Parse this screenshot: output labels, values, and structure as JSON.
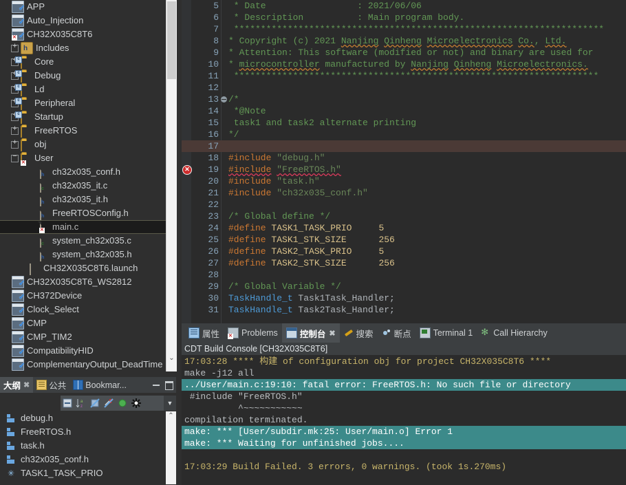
{
  "project_explorer": {
    "items": [
      {
        "label": "APP",
        "icon": "project-icon",
        "indent": 0,
        "twisty": "none",
        "kind": "project"
      },
      {
        "label": "Auto_Injection",
        "icon": "project-icon",
        "indent": 0,
        "twisty": "none",
        "kind": "project"
      },
      {
        "label": "CH32X035C8T6",
        "icon": "project-icon-error",
        "indent": 0,
        "twisty": "none",
        "kind": "project"
      },
      {
        "label": "Includes",
        "icon": "includes-icon",
        "indent": 1,
        "twisty": "plus",
        "kind": "includes"
      },
      {
        "label": "Core",
        "icon": "source-folder-icon",
        "indent": 1,
        "twisty": "plus",
        "kind": "srcfolder"
      },
      {
        "label": "Debug",
        "icon": "source-folder-icon",
        "indent": 1,
        "twisty": "plus",
        "kind": "srcfolder"
      },
      {
        "label": "Ld",
        "icon": "source-folder-icon",
        "indent": 1,
        "twisty": "plus",
        "kind": "srcfolder"
      },
      {
        "label": "Peripheral",
        "icon": "source-folder-icon",
        "indent": 1,
        "twisty": "plus",
        "kind": "srcfolder"
      },
      {
        "label": "Startup",
        "icon": "source-folder-icon",
        "indent": 1,
        "twisty": "plus",
        "kind": "srcfolder"
      },
      {
        "label": "FreeRTOS",
        "icon": "folder-icon",
        "indent": 1,
        "twisty": "plus",
        "kind": "folder"
      },
      {
        "label": "obj",
        "icon": "folder-icon",
        "indent": 1,
        "twisty": "plus",
        "kind": "folder"
      },
      {
        "label": "User",
        "icon": "folder-icon-error",
        "indent": 1,
        "twisty": "minus",
        "kind": "folder-err"
      },
      {
        "label": "ch32x035_conf.h",
        "icon": "header-file-icon",
        "indent": 3,
        "twisty": "none",
        "kind": "h"
      },
      {
        "label": "ch32x035_it.c",
        "icon": "c-file-icon",
        "indent": 3,
        "twisty": "none",
        "kind": "c"
      },
      {
        "label": "ch32x035_it.h",
        "icon": "header-file-icon",
        "indent": 3,
        "twisty": "none",
        "kind": "h"
      },
      {
        "label": "FreeRTOSConfig.h",
        "icon": "header-file-icon",
        "indent": 3,
        "twisty": "none",
        "kind": "h"
      },
      {
        "label": "main.c",
        "icon": "c-file-icon-error",
        "indent": 3,
        "twisty": "none",
        "kind": "c-err",
        "selected": true
      },
      {
        "label": "system_ch32x035.c",
        "icon": "c-file-icon",
        "indent": 3,
        "twisty": "none",
        "kind": "c"
      },
      {
        "label": "system_ch32x035.h",
        "icon": "header-file-icon",
        "indent": 3,
        "twisty": "none",
        "kind": "h"
      },
      {
        "label": "CH32X035C8T6.launch",
        "icon": "launch-file-icon",
        "indent": 2,
        "twisty": "none",
        "kind": "launch"
      },
      {
        "label": "CH32X035C8T6_WS2812",
        "icon": "project-icon",
        "indent": 0,
        "twisty": "none",
        "kind": "project"
      },
      {
        "label": "CH372Device",
        "icon": "project-icon",
        "indent": 0,
        "twisty": "none",
        "kind": "project"
      },
      {
        "label": "Clock_Select",
        "icon": "project-icon",
        "indent": 0,
        "twisty": "none",
        "kind": "project"
      },
      {
        "label": "CMP",
        "icon": "project-icon",
        "indent": 0,
        "twisty": "none",
        "kind": "project"
      },
      {
        "label": "CMP_TIM2",
        "icon": "project-icon",
        "indent": 0,
        "twisty": "none",
        "kind": "project"
      },
      {
        "label": "CompatibilityHID",
        "icon": "project-icon",
        "indent": 0,
        "twisty": "none",
        "kind": "project"
      },
      {
        "label": "ComplementaryOutput_DeadTime",
        "icon": "project-icon",
        "indent": 0,
        "twisty": "none",
        "kind": "project"
      }
    ]
  },
  "outline_panel": {
    "tabs": [
      {
        "label": "大纲",
        "active": true,
        "closable": true,
        "icon": "outline-icon"
      },
      {
        "label": "公共",
        "active": false,
        "closable": false,
        "icon": "public-icon"
      },
      {
        "label": "Bookmar...",
        "active": false,
        "closable": false,
        "icon": "bookmark-icon"
      }
    ],
    "window_buttons": [
      "minimize",
      "maximize"
    ],
    "toolbar_icons": [
      "collapse-all-icon",
      "sort-icon",
      "hide-fields-icon",
      "hide-static-icon",
      "hide-nonpublic-icon",
      "hide-macros-icon",
      "view-menu-icon"
    ],
    "items": [
      {
        "label": "debug.h",
        "icon": "include-icon"
      },
      {
        "label": "FreeRTOS.h",
        "icon": "include-icon"
      },
      {
        "label": "task.h",
        "icon": "include-icon"
      },
      {
        "label": "ch32x035_conf.h",
        "icon": "include-icon"
      },
      {
        "label": "TASK1_TASK_PRIO",
        "icon": "macro-icon"
      }
    ]
  },
  "editor": {
    "lines": [
      {
        "n": "5",
        "marker": "",
        "fold": false,
        "segs": [
          {
            "t": " * Date                 : 2021/06/06",
            "c": "cmt"
          }
        ]
      },
      {
        "n": "6",
        "marker": "",
        "fold": false,
        "segs": [
          {
            "t": " * Description          : Main program body.",
            "c": "cmt"
          }
        ]
      },
      {
        "n": "7",
        "marker": "",
        "fold": false,
        "segs": [
          {
            "t": " *********************************************************************",
            "c": "cmt"
          }
        ]
      },
      {
        "n": "8",
        "marker": "",
        "fold": false,
        "segs": [
          {
            "t": "* Copyright (c) 2021 ",
            "c": "cmt"
          },
          {
            "t": "Nanjing",
            "c": "cmt wavy-o"
          },
          {
            "t": " ",
            "c": "cmt"
          },
          {
            "t": "Qinheng",
            "c": "cmt wavy-o"
          },
          {
            "t": " ",
            "c": "cmt"
          },
          {
            "t": "Microelectronics",
            "c": "cmt wavy-o"
          },
          {
            "t": " ",
            "c": "cmt"
          },
          {
            "t": "Co.",
            "c": "cmt wavy-o"
          },
          {
            "t": ", ",
            "c": "cmt"
          },
          {
            "t": "Ltd.",
            "c": "cmt wavy-o"
          }
        ]
      },
      {
        "n": "9",
        "marker": "",
        "fold": false,
        "segs": [
          {
            "t": "* Attention: This software (modified or not) and binary are used for",
            "c": "cmt"
          }
        ]
      },
      {
        "n": "10",
        "marker": "",
        "fold": false,
        "segs": [
          {
            "t": "* ",
            "c": "cmt"
          },
          {
            "t": "microcontroller",
            "c": "cmt wavy-o"
          },
          {
            "t": " manufactured by ",
            "c": "cmt"
          },
          {
            "t": "Nanjing",
            "c": "cmt wavy-o"
          },
          {
            "t": " ",
            "c": "cmt"
          },
          {
            "t": "Qinheng",
            "c": "cmt wavy-o"
          },
          {
            "t": " ",
            "c": "cmt"
          },
          {
            "t": "Microelectronics.",
            "c": "cmt wavy-o"
          }
        ]
      },
      {
        "n": "11",
        "marker": "",
        "fold": false,
        "segs": [
          {
            "t": " ********************************************************************",
            "c": "cmt"
          }
        ]
      },
      {
        "n": "12",
        "marker": "",
        "fold": false,
        "segs": [
          {
            "t": "",
            "c": "pln"
          }
        ]
      },
      {
        "n": "13",
        "marker": "",
        "fold": true,
        "segs": [
          {
            "t": "/*",
            "c": "cmt"
          }
        ]
      },
      {
        "n": "14",
        "marker": "",
        "fold": false,
        "segs": [
          {
            "t": " *@Note",
            "c": "cmt"
          }
        ]
      },
      {
        "n": "15",
        "marker": "",
        "fold": false,
        "segs": [
          {
            "t": " task1 and task2 alternate printing",
            "c": "cmt"
          }
        ]
      },
      {
        "n": "16",
        "marker": "",
        "fold": false,
        "segs": [
          {
            "t": "*/",
            "c": "cmt"
          }
        ]
      },
      {
        "n": "17",
        "marker": "",
        "fold": false,
        "cursor": true,
        "segs": [
          {
            "t": "",
            "c": "pln"
          }
        ]
      },
      {
        "n": "18",
        "marker": "",
        "fold": false,
        "segs": [
          {
            "t": "#include",
            "c": "kw"
          },
          {
            "t": " ",
            "c": "pln"
          },
          {
            "t": "\"debug.h\"",
            "c": "str"
          }
        ]
      },
      {
        "n": "19",
        "marker": "error",
        "fold": false,
        "segs": [
          {
            "t": "#include",
            "c": "kw wavy-r"
          },
          {
            "t": " ",
            "c": "pln"
          },
          {
            "t": "\"FreeRTOS.h\"",
            "c": "str wavy-r"
          }
        ]
      },
      {
        "n": "20",
        "marker": "",
        "fold": false,
        "segs": [
          {
            "t": "#include",
            "c": "kw"
          },
          {
            "t": " ",
            "c": "pln"
          },
          {
            "t": "\"task.h\"",
            "c": "str"
          }
        ]
      },
      {
        "n": "21",
        "marker": "",
        "fold": false,
        "segs": [
          {
            "t": "#include",
            "c": "kw"
          },
          {
            "t": " ",
            "c": "pln"
          },
          {
            "t": "\"ch32x035_conf.h\"",
            "c": "str"
          }
        ]
      },
      {
        "n": "22",
        "marker": "",
        "fold": false,
        "segs": [
          {
            "t": "",
            "c": "pln"
          }
        ]
      },
      {
        "n": "23",
        "marker": "",
        "fold": false,
        "segs": [
          {
            "t": "/* Global define */",
            "c": "cmt"
          }
        ]
      },
      {
        "n": "24",
        "marker": "",
        "fold": false,
        "segs": [
          {
            "t": "#define",
            "c": "kw"
          },
          {
            "t": " ",
            "c": "pln"
          },
          {
            "t": "TASK1_TASK_PRIO",
            "c": "num"
          },
          {
            "t": "     5",
            "c": "num"
          }
        ]
      },
      {
        "n": "25",
        "marker": "",
        "fold": false,
        "segs": [
          {
            "t": "#define",
            "c": "kw"
          },
          {
            "t": " ",
            "c": "pln"
          },
          {
            "t": "TASK1_STK_SIZE",
            "c": "num"
          },
          {
            "t": "      256",
            "c": "num"
          }
        ]
      },
      {
        "n": "26",
        "marker": "",
        "fold": false,
        "segs": [
          {
            "t": "#define",
            "c": "kw"
          },
          {
            "t": " ",
            "c": "pln"
          },
          {
            "t": "TASK2_TASK_PRIO",
            "c": "num"
          },
          {
            "t": "     5",
            "c": "num"
          }
        ]
      },
      {
        "n": "27",
        "marker": "",
        "fold": false,
        "segs": [
          {
            "t": "#define",
            "c": "kw"
          },
          {
            "t": " ",
            "c": "pln"
          },
          {
            "t": "TASK2_STK_SIZE",
            "c": "num"
          },
          {
            "t": "      256",
            "c": "num"
          }
        ]
      },
      {
        "n": "28",
        "marker": "",
        "fold": false,
        "segs": [
          {
            "t": "",
            "c": "pln"
          }
        ]
      },
      {
        "n": "29",
        "marker": "",
        "fold": false,
        "segs": [
          {
            "t": "/* Global Variable */",
            "c": "cmt"
          }
        ]
      },
      {
        "n": "30",
        "marker": "",
        "fold": false,
        "segs": [
          {
            "t": "TaskHandle_t",
            "c": "typ"
          },
          {
            "t": " Task1Task_Handler;",
            "c": "pln"
          }
        ]
      },
      {
        "n": "31",
        "marker": "",
        "fold": false,
        "segs": [
          {
            "t": "TaskHandle_t",
            "c": "typ"
          },
          {
            "t": " Task2Task_Handler;",
            "c": "pln"
          }
        ]
      }
    ]
  },
  "console_panel": {
    "tabs": [
      {
        "label": "属性",
        "active": false,
        "closable": false,
        "icon": "properties-icon"
      },
      {
        "label": "Problems",
        "active": false,
        "closable": false,
        "icon": "problems-icon"
      },
      {
        "label": "控制台",
        "active": true,
        "closable": true,
        "icon": "console-icon"
      },
      {
        "label": "搜索",
        "active": false,
        "closable": false,
        "icon": "search-icon"
      },
      {
        "label": "断点",
        "active": false,
        "closable": false,
        "icon": "breakpoints-icon"
      },
      {
        "label": "Terminal 1",
        "active": false,
        "closable": false,
        "icon": "terminal-icon"
      },
      {
        "label": "Call Hierarchy",
        "active": false,
        "closable": false,
        "icon": "call-hierarchy-icon"
      }
    ],
    "title": "CDT Build Console [CH32X035C8T6]",
    "output": [
      {
        "text": "17:03:28 **** 构建 of configuration obj for project CH32X035C8T6 ****",
        "style": "ts"
      },
      {
        "text": "make -j12 all",
        "style": "plain"
      },
      {
        "text": "../User/main.c:19:10: fatal error: FreeRTOS.h: No such file or directory",
        "style": "err"
      },
      {
        "text": " #include \"FreeRTOS.h\"",
        "style": "plain"
      },
      {
        "text": "          ^~~~~~~~~~~~",
        "style": "plain"
      },
      {
        "text": "compilation terminated.",
        "style": "plain"
      },
      {
        "text": "make: *** [User/subdir.mk:25: User/main.o] Error 1",
        "style": "err"
      },
      {
        "text": "make: *** Waiting for unfinished jobs....",
        "style": "err"
      },
      {
        "text": "",
        "style": "plain"
      },
      {
        "text": "17:03:29 Build Failed. 3 errors, 0 warnings. (took 1s.270ms)",
        "style": "ts"
      }
    ]
  },
  "colors": {
    "editor_bg": "#2b2b2b",
    "panel_bg": "#2f2f2f",
    "tab_bg": "#3c3f41",
    "active_tab_bg": "#4b4f52",
    "error_highlight": "#3c8a8a",
    "timestamp": "#c8b56a",
    "comment": "#629755",
    "keyword": "#cc7832",
    "string": "#6a8759",
    "type": "#4e9ad6"
  }
}
